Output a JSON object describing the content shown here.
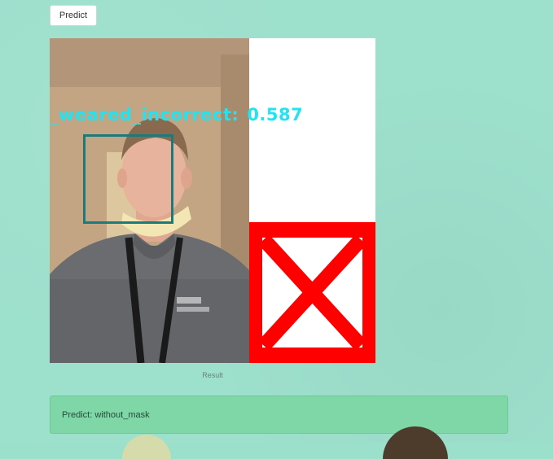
{
  "toolbar": {
    "predict_label": "Predict"
  },
  "result": {
    "detection_class": "_weared_incorrect:",
    "detection_score": "0.587",
    "caption": "Result"
  },
  "alert": {
    "text": "Predict: without_mask"
  },
  "colors": {
    "background": "#9de0cc",
    "label_text": "#22e3ef",
    "bbox": "#1c7a7d",
    "x_mark": "#ff0000",
    "alert_bg": "#7fd6a7"
  }
}
